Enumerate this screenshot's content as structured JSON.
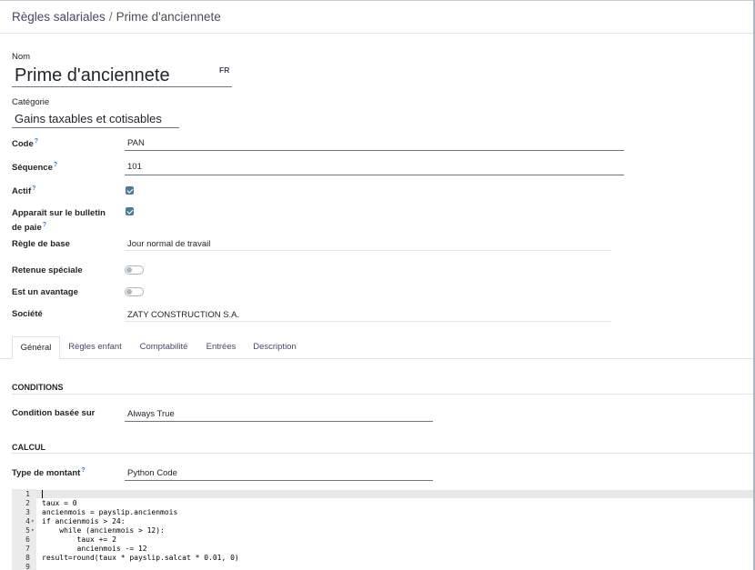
{
  "breadcrumb": {
    "parent": "Règles salariales",
    "separator": "/",
    "current": "Prime d'anciennete"
  },
  "form": {
    "name_label": "Nom",
    "name_value": "Prime d'anciennete",
    "lang_badge": "FR",
    "category_label": "Catégorie",
    "category_value": "Gains taxables et cotisables",
    "code_label": "Code",
    "code_value": "PAN",
    "sequence_label": "Séquence",
    "sequence_value": "101",
    "active_label": "Actif",
    "active_checked": true,
    "payslip_label_line1": "Apparaît sur le bulletin",
    "payslip_label_line2": "de paie",
    "payslip_checked": true,
    "base_rule_label": "Règle de base",
    "base_rule_value": "Jour normal de travail",
    "special_retention_label": "Retenue spéciale",
    "special_retention_on": false,
    "benefit_label": "Est un avantage",
    "benefit_on": false,
    "company_label": "Société",
    "company_value": "ZATY CONSTRUCTION S.A.",
    "help_mark": "?"
  },
  "tabs": [
    {
      "label": "Général",
      "active": true
    },
    {
      "label": "Règles enfant",
      "active": false
    },
    {
      "label": "Comptabilité",
      "active": false
    },
    {
      "label": "Entrées",
      "active": false
    },
    {
      "label": "Description",
      "active": false
    }
  ],
  "conditions": {
    "title": "CONDITIONS",
    "based_on_label": "Condition basée sur",
    "based_on_value": "Always True"
  },
  "calcul": {
    "title": "CALCUL",
    "amount_type_label": "Type de montant",
    "amount_type_value": "Python Code"
  },
  "code_lines": [
    {
      "n": "1",
      "fold": "",
      "text": ""
    },
    {
      "n": "2",
      "fold": "",
      "text": "taux = 0"
    },
    {
      "n": "3",
      "fold": "",
      "text": "ancienmois = payslip.ancienmois"
    },
    {
      "n": "4",
      "fold": "▾",
      "text": "if ancienmois > 24:"
    },
    {
      "n": "5",
      "fold": "▾",
      "text": "    while (ancienmois > 12):"
    },
    {
      "n": "6",
      "fold": "",
      "text": "        taux += 2"
    },
    {
      "n": "7",
      "fold": "",
      "text": "        ancienmois -= 12"
    },
    {
      "n": "8",
      "fold": "",
      "text": "result=round(taux * payslip.salcat * 0.01, 0)"
    },
    {
      "n": "9",
      "fold": "",
      "text": ""
    }
  ],
  "colors": {
    "accent": "#4d4469",
    "checkbox": "#4d7a96",
    "help": "#3a7bc8"
  }
}
